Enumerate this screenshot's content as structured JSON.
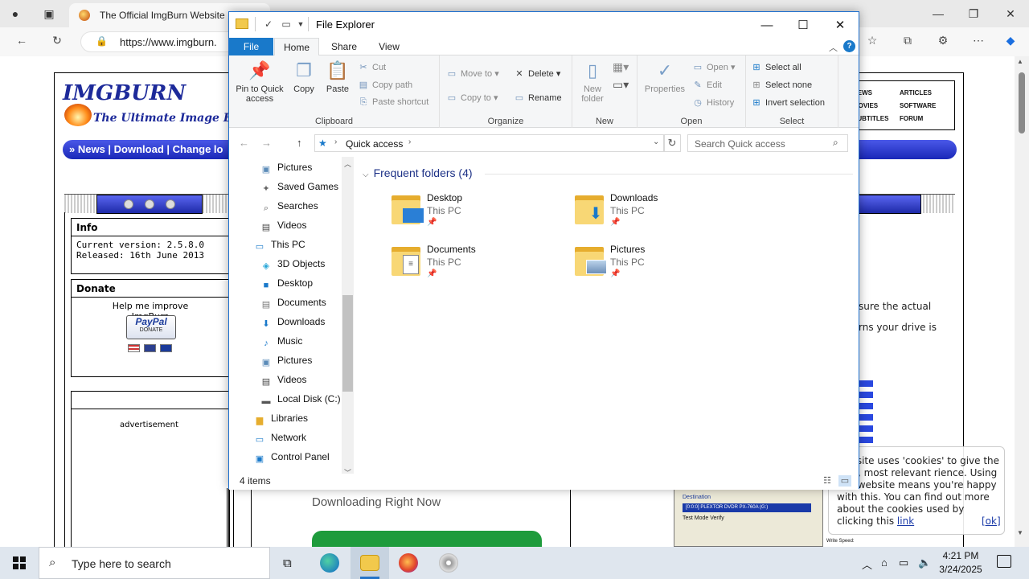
{
  "browser": {
    "tab_title": "The Official ImgBurn Website",
    "tab_close": "×",
    "url": "https://www.imgburn.",
    "window_controls": {
      "minimize": "—",
      "maximize": "❐",
      "close": "✕"
    }
  },
  "webpage": {
    "logo_title": "IMGBURN",
    "logo_subtitle": "The Ultimate Image Bur",
    "nav_text": "» News | Download | Change lo",
    "right_links": [
      "ARTICLES",
      "SOFTWARE",
      "FORUM",
      "NEWS",
      "MOVIES",
      "SUBTITLES"
    ],
    "info_title": "Info",
    "info_version": "Current version: 2.5.8.0",
    "info_released": "Released: 16th June 2013",
    "donate_title": "Donate",
    "donate_text_1": "Help me improve",
    "donate_text_2": "ImgBurn",
    "paypal_logo": "PayPal",
    "paypal_donate": "DONATE",
    "ad_label": "advertisement",
    "snippet_1": "sure the actual",
    "snippet_2": "rns your drive is",
    "downloading_now": "Downloading Right Now",
    "ss_destination": "Destination",
    "ss_drive": "[0:0:0] PLEXTOR DVDR  PX-760A (G:)",
    "ss_options": "Test Mode   Verify",
    "ss_write_speed": "Write Speed:"
  },
  "cookie": {
    "text": "website uses 'cookies' to give the best, most relevant rience. Using this website means you're happy with this. You can find out more about the cookies used by clicking this",
    "link": "link",
    "ok": "[ok]"
  },
  "explorer": {
    "title": "File Explorer",
    "tabs": {
      "file": "File",
      "home": "Home",
      "share": "Share",
      "view": "View"
    },
    "help": "?",
    "ribbon": {
      "clipboard": {
        "label": "Clipboard",
        "pin": "Pin to Quick access",
        "copy": "Copy",
        "paste": "Paste",
        "cut": "Cut",
        "copy_path": "Copy path",
        "paste_shortcut": "Paste shortcut"
      },
      "organize": {
        "label": "Organize",
        "move_to": "Move to",
        "copy_to": "Copy to",
        "delete": "Delete",
        "rename": "Rename"
      },
      "new": {
        "label": "New",
        "new_folder": "New folder"
      },
      "open": {
        "label": "Open",
        "properties": "Properties",
        "open": "Open",
        "edit": "Edit",
        "history": "History"
      },
      "select": {
        "label": "Select",
        "select_all": "Select all",
        "select_none": "Select none",
        "invert": "Invert selection"
      }
    },
    "address": {
      "location": "Quick access"
    },
    "search_placeholder": "Search Quick access",
    "nav_items": [
      {
        "label": "Pictures",
        "icon": "pictures-icon"
      },
      {
        "label": "Saved Games",
        "icon": "saved-games-icon"
      },
      {
        "label": "Searches",
        "icon": "searches-icon"
      },
      {
        "label": "Videos",
        "icon": "videos-icon"
      },
      {
        "label": "This PC",
        "icon": "this-pc-icon"
      },
      {
        "label": "3D Objects",
        "icon": "3d-objects-icon"
      },
      {
        "label": "Desktop",
        "icon": "desktop-icon"
      },
      {
        "label": "Documents",
        "icon": "documents-icon"
      },
      {
        "label": "Downloads",
        "icon": "downloads-icon"
      },
      {
        "label": "Music",
        "icon": "music-icon"
      },
      {
        "label": "Pictures",
        "icon": "pictures-icon"
      },
      {
        "label": "Videos",
        "icon": "videos-icon"
      },
      {
        "label": "Local Disk (C:)",
        "icon": "local-disk-icon"
      },
      {
        "label": "Libraries",
        "icon": "libraries-icon"
      },
      {
        "label": "Network",
        "icon": "network-icon"
      },
      {
        "label": "Control Panel",
        "icon": "control-panel-icon"
      }
    ],
    "frequent_header": "Frequent folders (4)",
    "folders": [
      {
        "name": "Desktop",
        "location": "This PC"
      },
      {
        "name": "Downloads",
        "location": "This PC"
      },
      {
        "name": "Documents",
        "location": "This PC"
      },
      {
        "name": "Pictures",
        "location": "This PC"
      }
    ],
    "status": "4 items"
  },
  "taskbar": {
    "search_placeholder": "Type here to search",
    "time": "4:21 PM",
    "date": "3/24/2025"
  }
}
